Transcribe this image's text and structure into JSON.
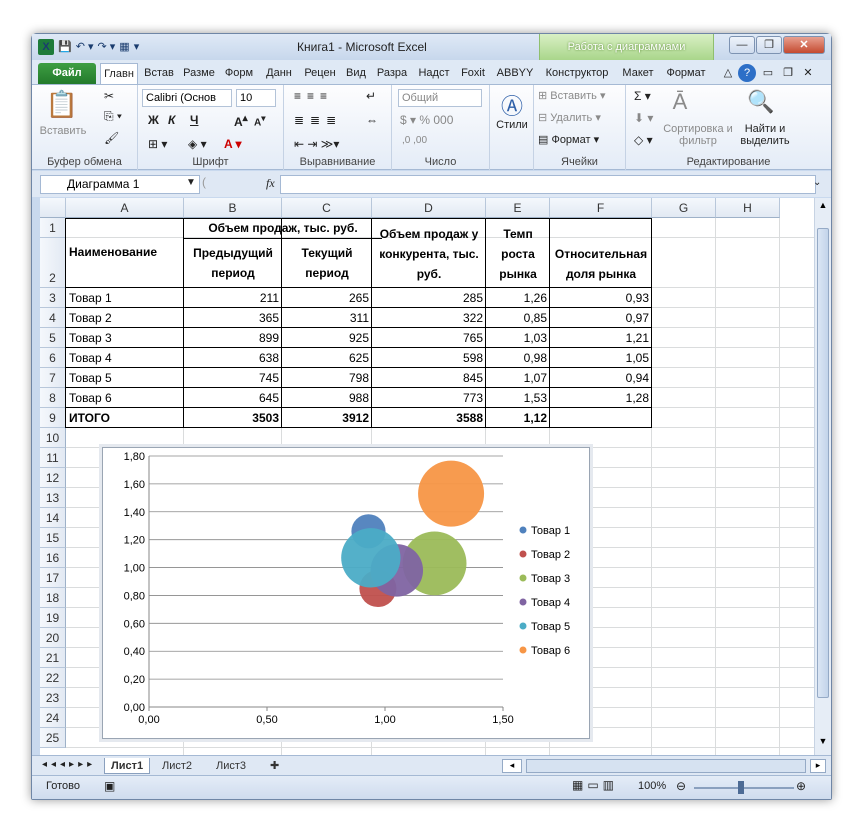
{
  "titlebar": {
    "title": "Книга1  -  Microsoft Excel",
    "context_tab": "Работа с диаграммами"
  },
  "tabs": [
    "Файл",
    "Главн",
    "Встав",
    "Разме",
    "Форм",
    "Данн",
    "Рецен",
    "Вид",
    "Разра",
    "Надст",
    "Foxit",
    "ABBYY",
    "Конструктор",
    "Макет",
    "Формат"
  ],
  "ribbon": {
    "paste": "Вставить",
    "clipboard": "Буфер обмена",
    "font_name": "Calibri (Основ",
    "font_size": "10",
    "font_group": "Шрифт",
    "bold": "Ж",
    "italic": "К",
    "underline": "Ч",
    "align_group": "Выравнивание",
    "number_format": "Общий",
    "number_group": "Число",
    "styles": "Стили",
    "insert": "Вставить",
    "delete": "Удалить",
    "format": "Формат",
    "cells_group": "Ячейки",
    "sigma": "Σ",
    "sort": "Сортировка и фильтр",
    "find": "Найти и выделить",
    "edit_group": "Редактирование"
  },
  "formula": {
    "namebox": "Диаграмма 1",
    "fx": "fx",
    "content": ""
  },
  "columns": [
    "A",
    "B",
    "C",
    "D",
    "E",
    "F",
    "G",
    "H"
  ],
  "rows": [
    "1",
    "2",
    "3",
    "4",
    "5",
    "6",
    "7",
    "8",
    "9",
    "10",
    "11",
    "12",
    "13",
    "14",
    "15",
    "16",
    "17",
    "18",
    "19",
    "20",
    "21",
    "22",
    "23",
    "24",
    "25"
  ],
  "table": {
    "h_name": "Наименование",
    "h_sales": "Объем продаж, тыс. руб.",
    "h_prev": "Предыдущий период",
    "h_cur": "Текущий период",
    "h_comp": "Объем продаж у конкурента, тыс. руб.",
    "h_growth": "Темп роста рынка",
    "h_share": "Относительная доля рынка",
    "data": [
      [
        "Товар 1",
        "211",
        "265",
        "285",
        "1,26",
        "0,93"
      ],
      [
        "Товар 2",
        "365",
        "311",
        "322",
        "0,85",
        "0,97"
      ],
      [
        "Товар 3",
        "899",
        "925",
        "765",
        "1,03",
        "1,21"
      ],
      [
        "Товар 4",
        "638",
        "625",
        "598",
        "0,98",
        "1,05"
      ],
      [
        "Товар 5",
        "745",
        "798",
        "845",
        "1,07",
        "0,94"
      ],
      [
        "Товар 6",
        "645",
        "988",
        "773",
        "1,53",
        "1,28"
      ]
    ],
    "total": [
      "ИТОГО",
      "3503",
      "3912",
      "3588",
      "1,12",
      ""
    ]
  },
  "chart_data": {
    "type": "bubble",
    "x_ticks": [
      "0,00",
      "0,50",
      "1,00",
      "1,50"
    ],
    "y_ticks": [
      "0,00",
      "0,20",
      "0,40",
      "0,60",
      "0,80",
      "1,00",
      "1,20",
      "1,40",
      "1,60",
      "1,80"
    ],
    "xlim": [
      0,
      1.5
    ],
    "ylim": [
      0,
      1.8
    ],
    "legend_position": "right",
    "series": [
      {
        "name": "Товар 1",
        "x": 0.93,
        "y": 1.26,
        "size": 265,
        "color": "#4f81bd"
      },
      {
        "name": "Товар 2",
        "x": 0.97,
        "y": 0.85,
        "size": 311,
        "color": "#c0504d"
      },
      {
        "name": "Товар 3",
        "x": 1.21,
        "y": 1.03,
        "size": 925,
        "color": "#9bbb59"
      },
      {
        "name": "Товар 4",
        "x": 1.05,
        "y": 0.98,
        "size": 625,
        "color": "#8064a2"
      },
      {
        "name": "Товар 5",
        "x": 0.94,
        "y": 1.07,
        "size": 798,
        "color": "#4bacc6"
      },
      {
        "name": "Товар 6",
        "x": 1.28,
        "y": 1.53,
        "size": 988,
        "color": "#f79646"
      }
    ]
  },
  "sheets": [
    "Лист1",
    "Лист2",
    "Лист3"
  ],
  "status": {
    "ready": "Готово",
    "zoom": "100%"
  }
}
